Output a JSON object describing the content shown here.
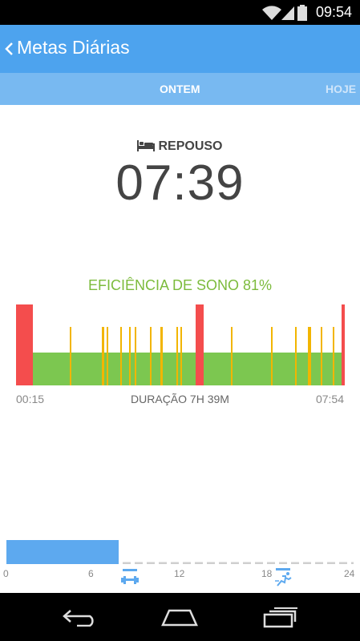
{
  "status_bar": {
    "time": "09:54"
  },
  "app_bar": {
    "title": "Metas Diárias"
  },
  "tabs": {
    "active": "ONTEM",
    "inactive": "HOJE"
  },
  "rest": {
    "label": "REPOUSO",
    "duration": "07:39"
  },
  "efficiency": {
    "label": "EFICIÊNCIA DE SONO 81%",
    "value_percent": 81
  },
  "sleep_chart": {
    "start_time": "00:15",
    "end_time": "07:54",
    "duration_label": "DURAÇÃO 7H 39M",
    "colors": {
      "awake": "#f44d4d",
      "sleep": "#7cc750",
      "disturbance": "#f2b500"
    }
  },
  "day_timeline": {
    "ticks": [
      "0",
      "6",
      "12",
      "18",
      "24"
    ],
    "fill_color": "#5da9ef",
    "fill_range_hours": [
      0,
      6.5
    ]
  },
  "icons": {
    "wifi": "wifi-icon",
    "signal": "signal-icon",
    "battery": "battery-icon",
    "back": "chevron-left-icon",
    "bed": "bed-icon",
    "dumbbell": "dumbbell-icon",
    "runner": "runner-icon",
    "nav_back": "nav-back-icon",
    "nav_home": "nav-home-icon",
    "nav_recents": "nav-recents-icon"
  }
}
